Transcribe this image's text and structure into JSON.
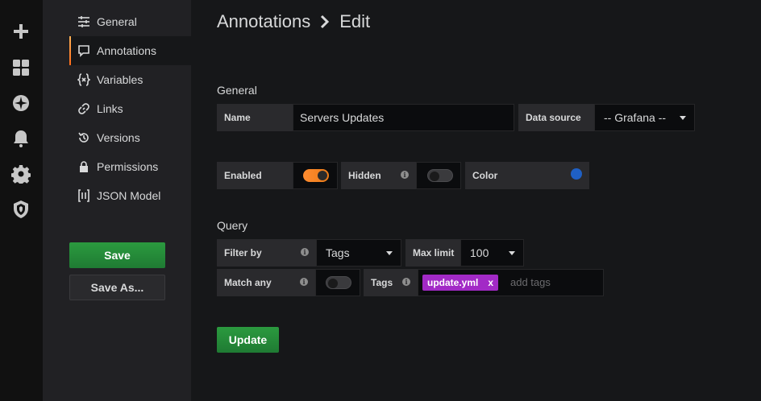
{
  "rail": {
    "icons": [
      "plus-icon",
      "dashboards-icon",
      "explore-icon",
      "alerting-icon",
      "configuration-icon",
      "shield-icon"
    ]
  },
  "sidebar": {
    "items": [
      {
        "label": "General",
        "icon": "sliders-icon"
      },
      {
        "label": "Annotations",
        "icon": "comment-icon",
        "active": true
      },
      {
        "label": "Variables",
        "icon": "variable-icon"
      },
      {
        "label": "Links",
        "icon": "link-icon"
      },
      {
        "label": "Versions",
        "icon": "history-icon"
      },
      {
        "label": "Permissions",
        "icon": "lock-icon"
      },
      {
        "label": "JSON Model",
        "icon": "json-icon"
      }
    ],
    "save_label": "Save",
    "save_as_label": "Save As..."
  },
  "breadcrumb": {
    "parent": "Annotations",
    "current": "Edit"
  },
  "general": {
    "title": "General",
    "name_label": "Name",
    "name_value": "Servers Updates",
    "datasource_label": "Data source",
    "datasource_value": "-- Grafana --",
    "enabled_label": "Enabled",
    "enabled": true,
    "hidden_label": "Hidden",
    "hidden": false,
    "color_label": "Color",
    "color": "#1f60c4"
  },
  "query": {
    "title": "Query",
    "filter_label": "Filter by",
    "filter_value": "Tags",
    "max_limit_label": "Max limit",
    "max_limit_value": "100",
    "match_any_label": "Match any",
    "match_any": false,
    "tags_label": "Tags",
    "tags": [
      "update.yml"
    ],
    "tag_remove": "x",
    "tags_placeholder": "add tags"
  },
  "update_label": "Update",
  "colors": {
    "accent_orange": "#eb7b18",
    "primary_green": "#299c46",
    "tag_purple": "#a22ac6"
  }
}
